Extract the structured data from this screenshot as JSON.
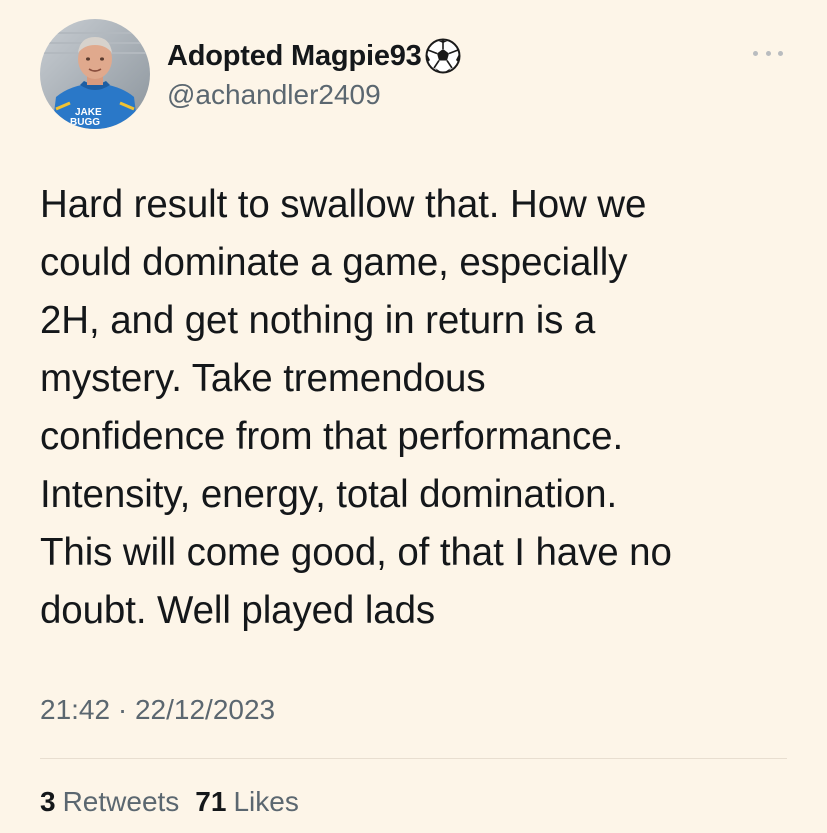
{
  "user": {
    "display_name": "Adopted Magpie93",
    "handle": "@achandler2409",
    "avatar_shirt_text_line1": "JAKE",
    "avatar_shirt_text_line2": "BUGG",
    "name_emoji": "soccer-ball-icon"
  },
  "tweet": {
    "text_lines": [
      "Hard result to swallow that. How we",
      "could dominate a game, especially",
      "2H, and get nothing in return is a",
      "mystery. Take tremendous",
      "confidence from that performance.",
      "Intensity, energy, total domination.",
      "This will come good, of that I have no",
      "doubt. Well played lads"
    ],
    "time": "21:42",
    "separator": "·",
    "date": "22/12/2023"
  },
  "stats": {
    "retweets_count": "3",
    "retweets_label": "Retweets",
    "likes_count": "71",
    "likes_label": "Likes"
  },
  "colors": {
    "background": "#fdf5e8",
    "text_primary": "#14171a",
    "text_secondary": "#5b6770",
    "divider": "#e8ded0"
  },
  "icons": {
    "more": "more-options-icon"
  }
}
